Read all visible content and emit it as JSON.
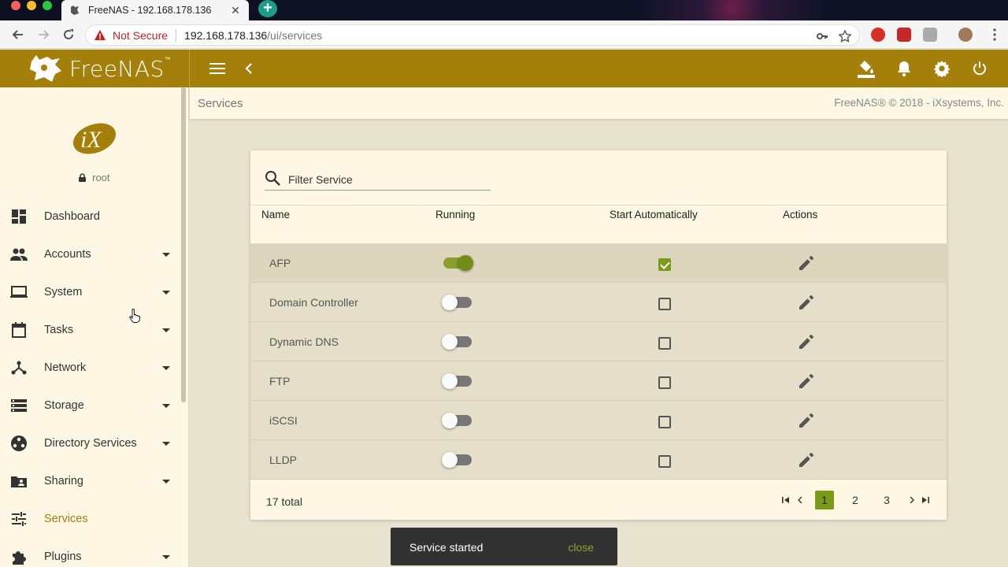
{
  "browser": {
    "tab_title": "FreeNAS - 192.168.178.136",
    "tab_close": "✕",
    "new_tab": "+",
    "security_label": "Not Secure",
    "url_host": "192.168.178.136",
    "url_path": "/ui/services"
  },
  "header": {
    "logo_text": "FreeNAS",
    "logo_tm": "™"
  },
  "sidebar": {
    "user": "root",
    "items": [
      {
        "label": "Dashboard",
        "icon": "dashboard-icon",
        "expandable": false
      },
      {
        "label": "Accounts",
        "icon": "people-icon",
        "expandable": true
      },
      {
        "label": "System",
        "icon": "laptop-icon",
        "expandable": true
      },
      {
        "label": "Tasks",
        "icon": "calendar-icon",
        "expandable": true
      },
      {
        "label": "Network",
        "icon": "network-icon",
        "expandable": true
      },
      {
        "label": "Storage",
        "icon": "storage-icon",
        "expandable": true
      },
      {
        "label": "Directory Services",
        "icon": "directory-icon",
        "expandable": true
      },
      {
        "label": "Sharing",
        "icon": "folder-shared-icon",
        "expandable": true
      },
      {
        "label": "Services",
        "icon": "tune-icon",
        "expandable": false,
        "active": true
      },
      {
        "label": "Plugins",
        "icon": "extension-icon",
        "expandable": true
      }
    ]
  },
  "breadcrumb": {
    "title": "Services",
    "copyright": "FreeNAS® © 2018 - iXsystems, Inc."
  },
  "services_table": {
    "filter_placeholder": "Filter Service",
    "columns": [
      "Name",
      "Running",
      "Start Automatically",
      "Actions"
    ],
    "rows": [
      {
        "name": "AFP",
        "running": true,
        "start_automatically": true
      },
      {
        "name": "Domain Controller",
        "running": false,
        "start_automatically": false
      },
      {
        "name": "Dynamic DNS",
        "running": false,
        "start_automatically": false
      },
      {
        "name": "FTP",
        "running": false,
        "start_automatically": false
      },
      {
        "name": "iSCSI",
        "running": false,
        "start_automatically": false
      },
      {
        "name": "LLDP",
        "running": false,
        "start_automatically": false
      }
    ],
    "total": "17 total",
    "pages": [
      "1",
      "2",
      "3"
    ],
    "current_page": "1"
  },
  "snackbar": {
    "message": "Service started",
    "action": "close"
  },
  "colors": {
    "header_bg": "#a4800a",
    "accent_green": "#7a9a1a",
    "sidebar_bg": "#fdf7e3"
  }
}
